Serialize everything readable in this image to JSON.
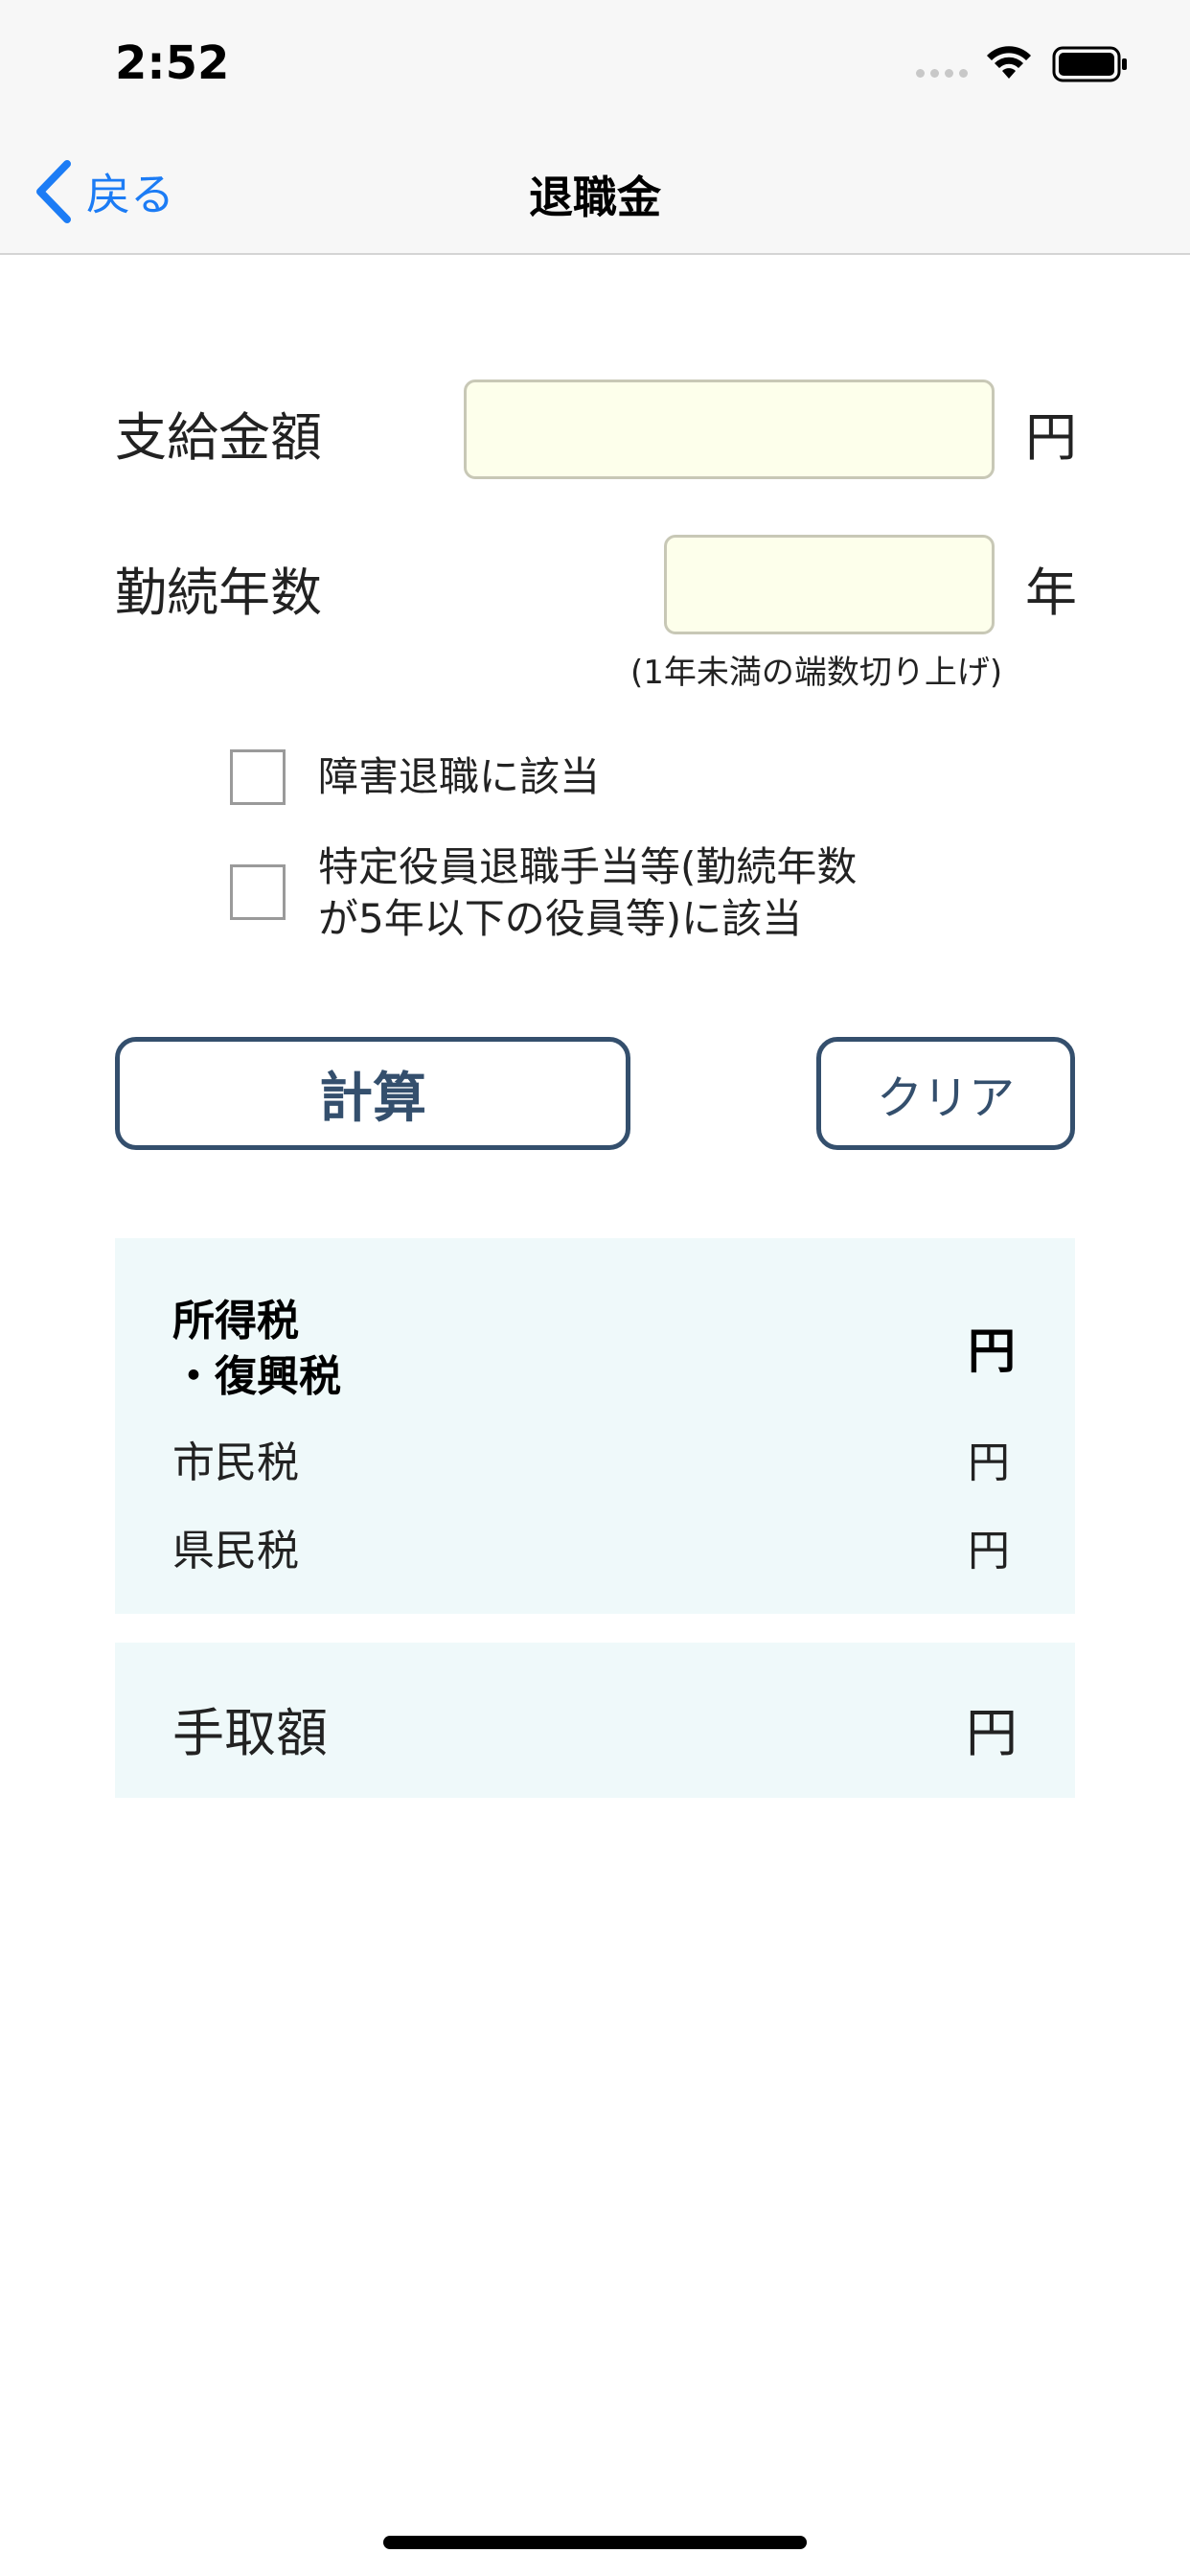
{
  "status_bar": {
    "time": "2:52"
  },
  "nav": {
    "back_label": "戻る",
    "title": "退職金"
  },
  "form": {
    "payment": {
      "label": "支給金額",
      "value": "",
      "unit": "円"
    },
    "years": {
      "label": "勤続年数",
      "value": "",
      "unit": "年",
      "note": "(1年未満の端数切り上げ)"
    },
    "checkbox1": {
      "label": "障害退職に該当",
      "checked": false
    },
    "checkbox2": {
      "label_line1": "特定役員退職手当等(勤続年数",
      "label_line2": "が5年以下の役員等)に該当",
      "checked": false
    }
  },
  "buttons": {
    "calculate": "計算",
    "clear": "クリア"
  },
  "results": {
    "income_tax": {
      "label_line1": "所得税",
      "label_line2": "・復興税",
      "unit": "円"
    },
    "city_tax": {
      "label": "市民税",
      "unit": "円"
    },
    "prefecture_tax": {
      "label": "県民税",
      "unit": "円"
    }
  },
  "net": {
    "label": "手取額",
    "unit": "円"
  }
}
